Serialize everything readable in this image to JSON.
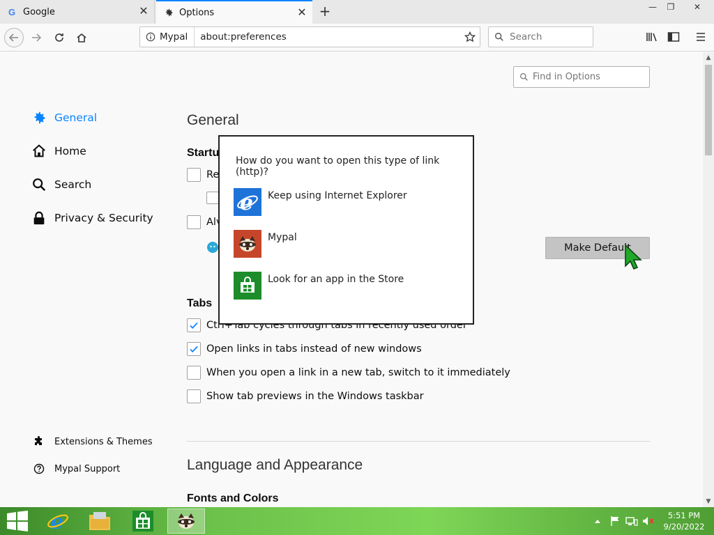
{
  "tabs": [
    {
      "title": "Google",
      "icon": "google-icon",
      "active": false
    },
    {
      "title": "Options",
      "icon": "gear-icon",
      "active": true
    }
  ],
  "navbar": {
    "identity_label": "Mypal",
    "url": "about:preferences",
    "search_placeholder": "Search"
  },
  "content": {
    "find_placeholder": "Find in Options",
    "sidebar": {
      "items": [
        {
          "label": "General",
          "icon": "gear-icon",
          "selected": true
        },
        {
          "label": "Home",
          "icon": "home-icon",
          "selected": false
        },
        {
          "label": "Search",
          "icon": "search-icon",
          "selected": false
        },
        {
          "label": "Privacy & Security",
          "icon": "lock-icon",
          "selected": false
        }
      ],
      "footer": [
        {
          "label": "Extensions & Themes",
          "icon": "puzzle-icon"
        },
        {
          "label": "Mypal Support",
          "icon": "help-icon"
        }
      ]
    },
    "general_title": "General",
    "startup_heading": "Startu",
    "startup_row1_text": "Re",
    "startup_row2_text": "Alv",
    "make_default_label": "Make Default",
    "tabs_heading": "Tabs",
    "tab_options": [
      {
        "label": "Ctrl+Tab cycles through tabs in recently used order",
        "checked": true
      },
      {
        "label": "Open links in tabs instead of new windows",
        "checked": true
      },
      {
        "label": "When you open a link in a new tab, switch to it immediately",
        "checked": false
      },
      {
        "label": "Show tab previews in the Windows taskbar",
        "checked": false
      }
    ],
    "language_title": "Language and Appearance",
    "fonts_heading": "Fonts and Colors"
  },
  "dialog": {
    "title": "How do you want to open this type of link (http)?",
    "options": [
      {
        "label": "Keep using Internet Explorer",
        "icon": "internet-explorer-icon"
      },
      {
        "label": "Mypal",
        "icon": "mypal-icon"
      },
      {
        "label": "Look for an app in the Store",
        "icon": "store-icon"
      }
    ]
  },
  "taskbar": {
    "clock_time": "5:51 PM",
    "clock_date": "9/20/2022"
  },
  "colors": {
    "accent": "#0a84ff",
    "taskbar": "#6cc24a",
    "ie_blue": "#1e73d9",
    "mypal_red": "#c6462b",
    "store_green": "#1c8d2a"
  }
}
